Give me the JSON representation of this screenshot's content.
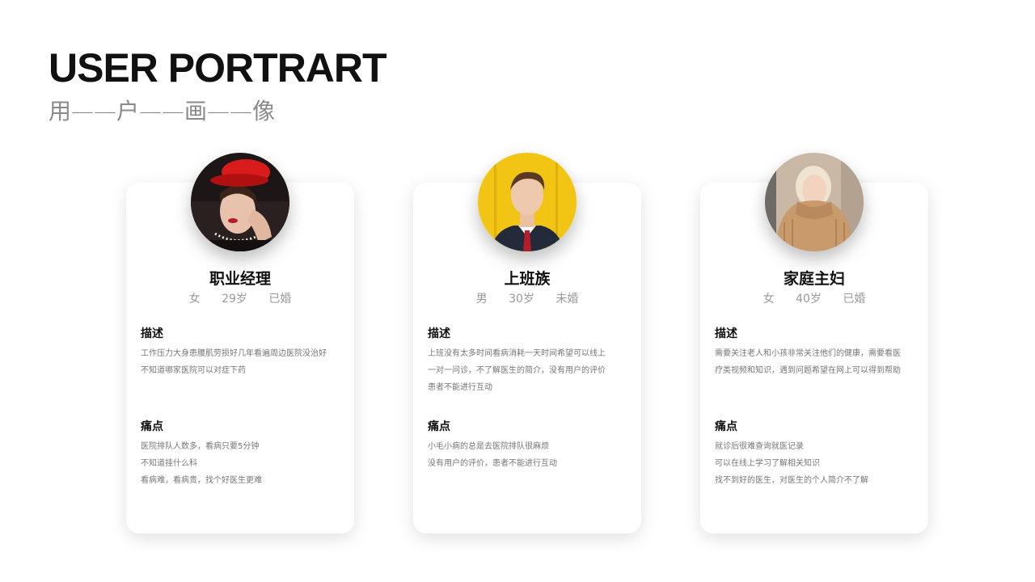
{
  "header": {
    "title": "USER PORTRART",
    "subtitle": "用——户——画——像"
  },
  "cards": [
    {
      "role": "职业经理",
      "gender": "女",
      "age": "29岁",
      "marital": "已婚",
      "desc_heading": "描述",
      "desc_lines": [
        "工作压力大身患腰肌劳损好几年看遍周边医院没治好",
        "不知道哪家医院可以对症下药"
      ],
      "pain_heading": "痛点",
      "pain_lines": [
        "医院排队人数多，看病只要5分钟",
        "不知道挂什么科",
        "看病难，看病贵，找个好医生更难"
      ]
    },
    {
      "role": "上班族",
      "gender": "男",
      "age": "30岁",
      "marital": "未婚",
      "desc_heading": "描述",
      "desc_lines": [
        "上班没有太多时间看病消耗一天时间希望可以线上",
        "一对一问诊，不了解医生的简介，没有用户的评价",
        "患者不能进行互动"
      ],
      "pain_heading": "痛点",
      "pain_lines": [
        "小毛小病的总是去医院排队很麻烦",
        "没有用户的评价，患者不能进行互动"
      ]
    },
    {
      "role": "家庭主妇",
      "gender": "女",
      "age": "40岁",
      "marital": "已婚",
      "desc_heading": "描述",
      "desc_lines": [
        "需要关注老人和小孩非常关注他们的健康，需要看医",
        "疗类视频和知识，遇到问题希望在网上可以得到帮助"
      ],
      "pain_heading": "痛点",
      "pain_lines": [
        "就诊后很难查询就医记录",
        "可以在线上学习了解相关知识",
        "找不到好的医生，对医生的个人简介不了解"
      ]
    }
  ]
}
